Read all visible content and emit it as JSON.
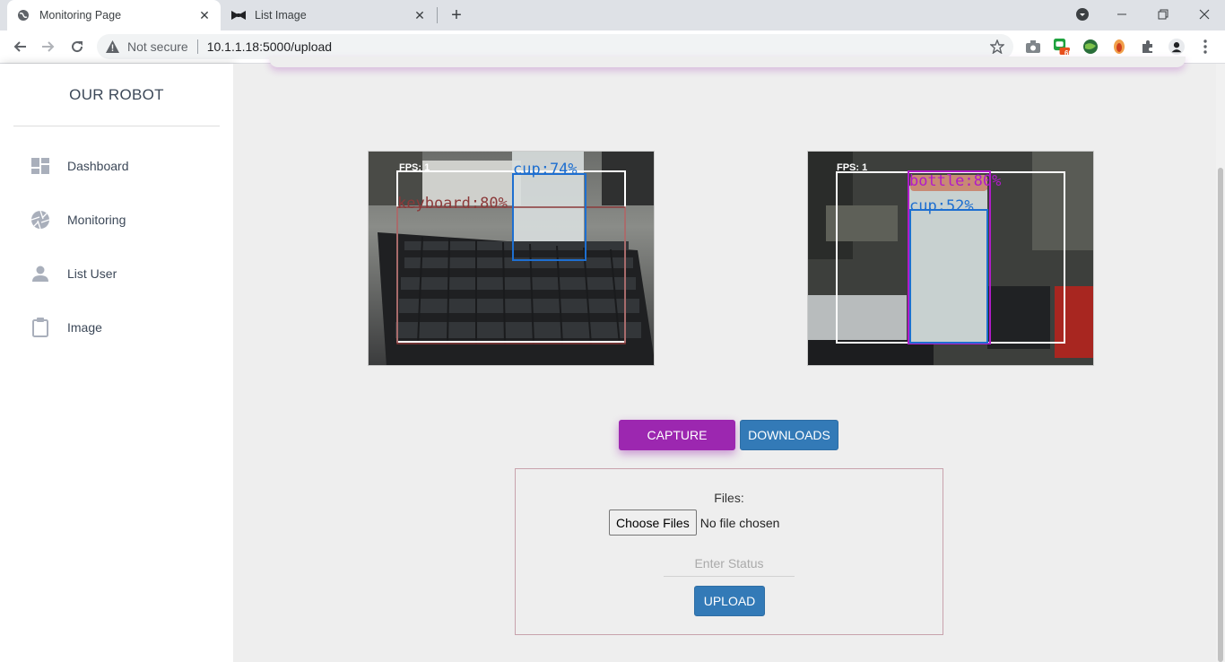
{
  "browser": {
    "tabs": [
      {
        "title": "Monitoring Page",
        "icon": "globe-icon",
        "active": true
      },
      {
        "title": "List Image",
        "icon": "bowtie-icon",
        "active": false
      }
    ],
    "url_security": "Not secure",
    "url": "10.1.1.18:5000/upload",
    "extension_badge": "60"
  },
  "sidebar": {
    "brand": "OUR ROBOT",
    "items": [
      {
        "label": "Dashboard",
        "icon": "dashboard-icon"
      },
      {
        "label": "Monitoring",
        "icon": "camera-shutter-icon"
      },
      {
        "label": "List User",
        "icon": "person-icon"
      },
      {
        "label": "Image",
        "icon": "clipboard-icon"
      }
    ]
  },
  "cameras": [
    {
      "fps_label": "FPS: 1",
      "detections": [
        {
          "label": "cup:74%",
          "color": "#1e6fd0"
        },
        {
          "label": "keyboard:80%",
          "color": "#8b3a3a"
        }
      ]
    },
    {
      "fps_label": "FPS: 1",
      "detections": [
        {
          "label": "bottle:80%",
          "color": "#b01cc9"
        },
        {
          "label": "cup:52%",
          "color": "#1e6fd0"
        }
      ]
    }
  ],
  "actions": {
    "capture": "CAPTURE",
    "downloads": "DOWNLOADS"
  },
  "upload": {
    "files_label": "Files:",
    "choose_button": "Choose Files",
    "no_file": "No file chosen",
    "status_placeholder": "Enter Status",
    "submit": "UPLOAD"
  },
  "colors": {
    "primary": "#9c27b0",
    "info": "#337ab7"
  }
}
